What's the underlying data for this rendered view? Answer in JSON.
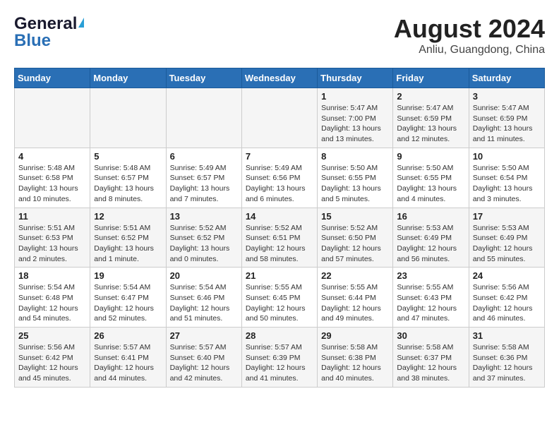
{
  "header": {
    "logo_line1": "General",
    "logo_line2": "Blue",
    "month": "August 2024",
    "location": "Anliu, Guangdong, China"
  },
  "weekdays": [
    "Sunday",
    "Monday",
    "Tuesday",
    "Wednesday",
    "Thursday",
    "Friday",
    "Saturday"
  ],
  "weeks": [
    [
      {
        "day": "",
        "info": ""
      },
      {
        "day": "",
        "info": ""
      },
      {
        "day": "",
        "info": ""
      },
      {
        "day": "",
        "info": ""
      },
      {
        "day": "1",
        "info": "Sunrise: 5:47 AM\nSunset: 7:00 PM\nDaylight: 13 hours\nand 13 minutes."
      },
      {
        "day": "2",
        "info": "Sunrise: 5:47 AM\nSunset: 6:59 PM\nDaylight: 13 hours\nand 12 minutes."
      },
      {
        "day": "3",
        "info": "Sunrise: 5:47 AM\nSunset: 6:59 PM\nDaylight: 13 hours\nand 11 minutes."
      }
    ],
    [
      {
        "day": "4",
        "info": "Sunrise: 5:48 AM\nSunset: 6:58 PM\nDaylight: 13 hours\nand 10 minutes."
      },
      {
        "day": "5",
        "info": "Sunrise: 5:48 AM\nSunset: 6:57 PM\nDaylight: 13 hours\nand 8 minutes."
      },
      {
        "day": "6",
        "info": "Sunrise: 5:49 AM\nSunset: 6:57 PM\nDaylight: 13 hours\nand 7 minutes."
      },
      {
        "day": "7",
        "info": "Sunrise: 5:49 AM\nSunset: 6:56 PM\nDaylight: 13 hours\nand 6 minutes."
      },
      {
        "day": "8",
        "info": "Sunrise: 5:50 AM\nSunset: 6:55 PM\nDaylight: 13 hours\nand 5 minutes."
      },
      {
        "day": "9",
        "info": "Sunrise: 5:50 AM\nSunset: 6:55 PM\nDaylight: 13 hours\nand 4 minutes."
      },
      {
        "day": "10",
        "info": "Sunrise: 5:50 AM\nSunset: 6:54 PM\nDaylight: 13 hours\nand 3 minutes."
      }
    ],
    [
      {
        "day": "11",
        "info": "Sunrise: 5:51 AM\nSunset: 6:53 PM\nDaylight: 13 hours\nand 2 minutes."
      },
      {
        "day": "12",
        "info": "Sunrise: 5:51 AM\nSunset: 6:52 PM\nDaylight: 13 hours\nand 1 minute."
      },
      {
        "day": "13",
        "info": "Sunrise: 5:52 AM\nSunset: 6:52 PM\nDaylight: 13 hours\nand 0 minutes."
      },
      {
        "day": "14",
        "info": "Sunrise: 5:52 AM\nSunset: 6:51 PM\nDaylight: 12 hours\nand 58 minutes."
      },
      {
        "day": "15",
        "info": "Sunrise: 5:52 AM\nSunset: 6:50 PM\nDaylight: 12 hours\nand 57 minutes."
      },
      {
        "day": "16",
        "info": "Sunrise: 5:53 AM\nSunset: 6:49 PM\nDaylight: 12 hours\nand 56 minutes."
      },
      {
        "day": "17",
        "info": "Sunrise: 5:53 AM\nSunset: 6:49 PM\nDaylight: 12 hours\nand 55 minutes."
      }
    ],
    [
      {
        "day": "18",
        "info": "Sunrise: 5:54 AM\nSunset: 6:48 PM\nDaylight: 12 hours\nand 54 minutes."
      },
      {
        "day": "19",
        "info": "Sunrise: 5:54 AM\nSunset: 6:47 PM\nDaylight: 12 hours\nand 52 minutes."
      },
      {
        "day": "20",
        "info": "Sunrise: 5:54 AM\nSunset: 6:46 PM\nDaylight: 12 hours\nand 51 minutes."
      },
      {
        "day": "21",
        "info": "Sunrise: 5:55 AM\nSunset: 6:45 PM\nDaylight: 12 hours\nand 50 minutes."
      },
      {
        "day": "22",
        "info": "Sunrise: 5:55 AM\nSunset: 6:44 PM\nDaylight: 12 hours\nand 49 minutes."
      },
      {
        "day": "23",
        "info": "Sunrise: 5:55 AM\nSunset: 6:43 PM\nDaylight: 12 hours\nand 47 minutes."
      },
      {
        "day": "24",
        "info": "Sunrise: 5:56 AM\nSunset: 6:42 PM\nDaylight: 12 hours\nand 46 minutes."
      }
    ],
    [
      {
        "day": "25",
        "info": "Sunrise: 5:56 AM\nSunset: 6:42 PM\nDaylight: 12 hours\nand 45 minutes."
      },
      {
        "day": "26",
        "info": "Sunrise: 5:57 AM\nSunset: 6:41 PM\nDaylight: 12 hours\nand 44 minutes."
      },
      {
        "day": "27",
        "info": "Sunrise: 5:57 AM\nSunset: 6:40 PM\nDaylight: 12 hours\nand 42 minutes."
      },
      {
        "day": "28",
        "info": "Sunrise: 5:57 AM\nSunset: 6:39 PM\nDaylight: 12 hours\nand 41 minutes."
      },
      {
        "day": "29",
        "info": "Sunrise: 5:58 AM\nSunset: 6:38 PM\nDaylight: 12 hours\nand 40 minutes."
      },
      {
        "day": "30",
        "info": "Sunrise: 5:58 AM\nSunset: 6:37 PM\nDaylight: 12 hours\nand 38 minutes."
      },
      {
        "day": "31",
        "info": "Sunrise: 5:58 AM\nSunset: 6:36 PM\nDaylight: 12 hours\nand 37 minutes."
      }
    ]
  ]
}
